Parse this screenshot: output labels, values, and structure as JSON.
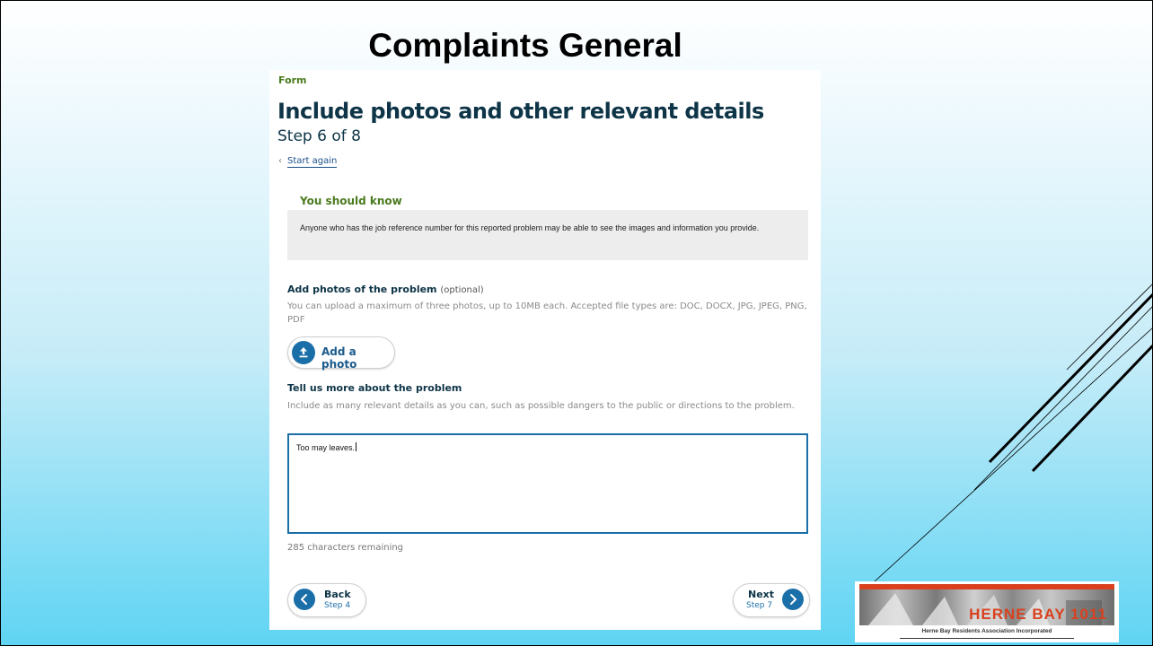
{
  "slide": {
    "title": "Complaints General"
  },
  "form": {
    "eyebrow": "Form",
    "heading": "Include photos and other relevant details",
    "step": "Step 6 of 8",
    "start_again": "Start again",
    "notice": {
      "title": "You should know",
      "body": "Anyone who has the job reference number for this reported problem may be able to see the images and information you provide."
    },
    "photos": {
      "label": "Add photos of the problem",
      "optional": "(optional)",
      "hint": "You can upload a maximum of three photos, up to 10MB each. Accepted file types are: DOC, DOCX, JPG, JPEG, PNG, PDF",
      "button": "Add a photo"
    },
    "details": {
      "label": "Tell us more about the problem",
      "hint": "Include as many relevant details as you can, such as possible dangers to the public or directions to the problem.",
      "value": "Too may leaves.",
      "remaining": "285 characters remaining"
    },
    "nav": {
      "back_label": "Back",
      "back_step": "Step 4",
      "next_label": "Next",
      "next_step": "Step 7"
    }
  },
  "logo": {
    "brand": "HERNE BAY 1011",
    "subtitle": "Herne Bay Residents Association Incorporated"
  },
  "colors": {
    "accent_blue": "#1b6fa8",
    "heading_navy": "#0d3447",
    "notice_green": "#4a7a1e",
    "logo_red": "#d9411e"
  }
}
